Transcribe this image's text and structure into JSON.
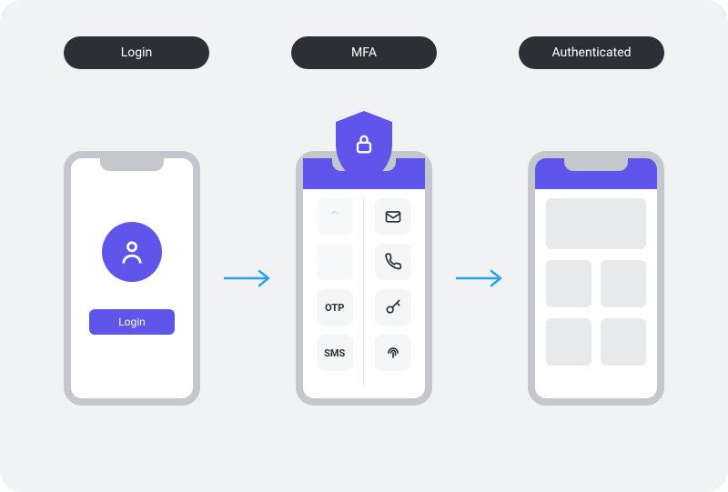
{
  "steps": {
    "one": "Login",
    "two": "MFA",
    "three": "Authenticated"
  },
  "login": {
    "button_label": "Login"
  },
  "mfa": {
    "otp_label": "OTP",
    "sms_label": "SMS"
  },
  "icons": {
    "shield": "shield-icon",
    "lock": "lock-icon",
    "user": "user-icon",
    "mail": "mail-icon",
    "phone": "phone-icon",
    "key": "key-icon",
    "fingerprint": "fingerprint-icon",
    "arrow": "arrow-right-icon"
  },
  "colors": {
    "accent": "#6055eb",
    "pill": "#2b3037",
    "arrow": "#2aa3ef",
    "frame": "#c4c8cc",
    "bg": "#f1f2f3"
  }
}
